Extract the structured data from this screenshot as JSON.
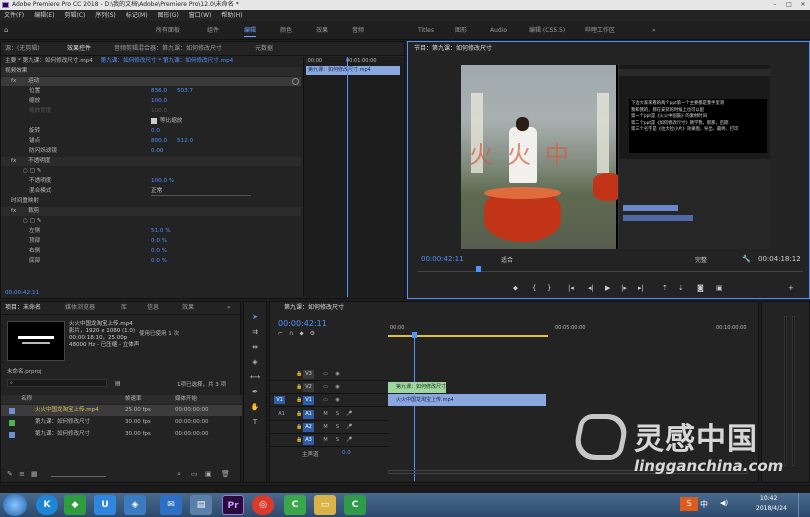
{
  "app": {
    "title": "Adobe Premiere Pro CC 2018 - D:\\我的文档\\Adobe\\Premiere Pro\\12.0\\未命名 *"
  },
  "menu": [
    "文件(F)",
    "编辑(E)",
    "剪辑(C)",
    "序列(S)",
    "标记(M)",
    "图形(G)",
    "窗口(W)",
    "帮助(H)"
  ],
  "workspaces": [
    "所有面板",
    "组件",
    "编辑",
    "颜色",
    "效果",
    "音频",
    "Titles",
    "图形",
    "Audio",
    "编辑 (CS5.5)",
    "哔哩工作区",
    "»"
  ],
  "workspace_active": "编辑",
  "effect_controls": {
    "tabs": [
      "源：(无剪辑)",
      "效果控件",
      "音频剪辑混合器：第九课：如何修改尺寸",
      "元数据"
    ],
    "clip_path": "主要 * 第九课：如何修改尺寸.mp4",
    "clip_path2": "第九课：如何修改尺寸 * 第九课：如何修改尺寸.mp4",
    "section_video": "视频效果",
    "motion": "运动",
    "position_label": "位置",
    "position_x": "836.0",
    "position_y": "503.7",
    "scale_label": "缩放",
    "scale_value": "100.0",
    "scale_width_label": "缩放宽度",
    "scale_width_value": "100.0",
    "uniform_scale": "等比缩放",
    "rotation_label": "旋转",
    "rotation_value": "0.0",
    "anchor_label": "锚点",
    "anchor_x": "800.0",
    "anchor_y": "512.0",
    "antiflicker_label": "防闪烁滤镜",
    "antiflicker_value": "0.00",
    "opacity": "不透明度",
    "opacity_label": "不透明度",
    "opacity_value": "100.0 %",
    "blend_label": "混合模式",
    "blend_value": "正常",
    "time_remap": "时间重映射",
    "crop": "裁剪",
    "left_label": "左侧",
    "left_value": "51.0 %",
    "top_label": "顶部",
    "top_value": "0.0 %",
    "right_label": "右侧",
    "right_value": "0.0 %",
    "bottom_label": "底部",
    "bottom_value": "0.0 %",
    "timecode": "00:00:42:11",
    "mini_timeline_start": ":00:00",
    "mini_timeline_end": "00:01:00:00",
    "mini_clip": "第九课：如何修改尺寸.mp4"
  },
  "program": {
    "title": "节目：第九课：如何修改尺寸",
    "timecode": "00:00:42:11",
    "fit": "适合",
    "quality": "完整",
    "duration": "00:04:18:12",
    "overlay_text": [
      "下边大家来看的两个ppt第一个主要都是我手里测",
      "我和我的，那在安装的时候上也可以配",
      "第一个ppt是《火火中国鼓》的素材时间",
      "第二个ppt是《如何修改尺寸》教学我，那那，后期",
      "第三个名字是《拉大拉小片》效果图，导出、最终、打印"
    ],
    "watermark_chars": "火火中"
  },
  "project": {
    "tabs": [
      "项目：未命名",
      "媒体浏览器",
      "库",
      "信息",
      "效果",
      "»"
    ],
    "clip_name": "火火中国龙淘宝上传.mp4",
    "clip_meta1": "影片，1920 x 1080 (1.0)",
    "clip_meta2": "00:00:18:10，25.00p",
    "clip_meta3": "48000 Hz - 已压缩 - 立体声",
    "clip_used": "使用已使用 1 次",
    "project_file": "未命名.prproj",
    "selection": "1项已选择，共 3 项",
    "columns": [
      "名称",
      "帧速率",
      "媒体开始"
    ],
    "items": [
      {
        "name": "火火中国龙淘宝上传.mp4",
        "fps": "25.00 fps",
        "start": "00:00:00:00",
        "color": "#6c8fd3"
      },
      {
        "name": "第九课：如何修改尺寸",
        "fps": "30.00 fps",
        "start": "00:00:00:00",
        "color": "#4db34d"
      },
      {
        "name": "第九课：如何修改尺寸",
        "fps": "30.00 fps",
        "start": "00:00:00:00",
        "color": "#6c8fd3"
      }
    ]
  },
  "timeline": {
    "title": "第九课：如何修改尺寸",
    "timecode": "00:00:42:11",
    "ruler": [
      "00:00",
      "00:05:00:00",
      "00:10:00:00"
    ],
    "video_tracks": [
      "V3",
      "V2",
      "V1"
    ],
    "audio_tracks": [
      "A1",
      "A2",
      "A3"
    ],
    "master": "主声道",
    "master_value": "0.0",
    "clip_v2": "第九课：如何修改尺寸",
    "clip_v1": "火火中国龙淘宝上传.mp4"
  },
  "taskbar": {
    "time": "10:42",
    "date": "2018/4/24",
    "ime": "中"
  },
  "watermark": {
    "brand": "灵感中国",
    "url": "lingganchina.com"
  },
  "colors": {
    "accent": "#4e93ff",
    "timecode": "#4e93ff",
    "selected_track": "#2f5ea8",
    "clip_v1": "#8aa7e0",
    "clip_v2": "#9fd59f"
  }
}
